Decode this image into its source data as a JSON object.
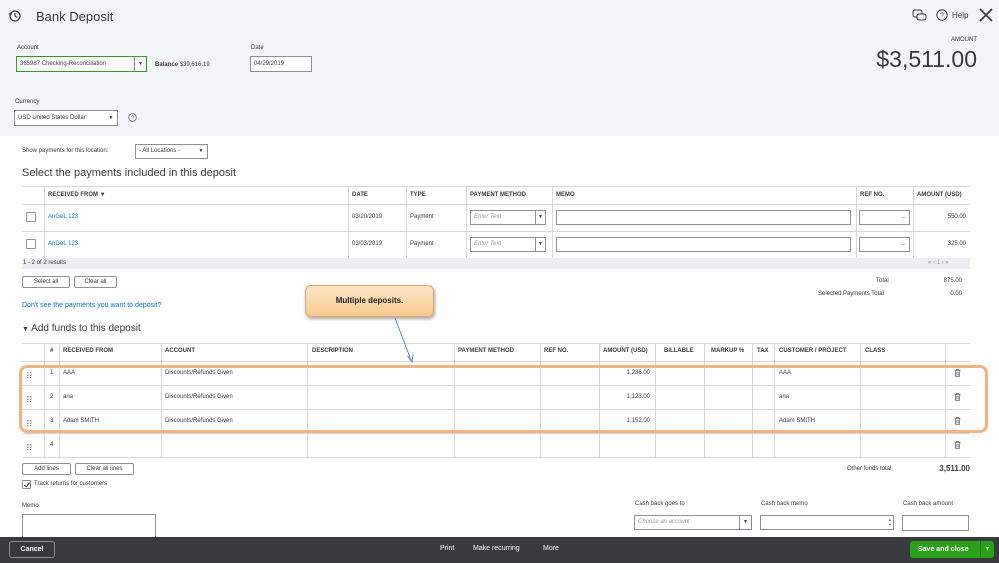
{
  "header": {
    "title": "Bank Deposit",
    "help_label": "Help",
    "amount_label": "AMOUNT",
    "amount_value": "$3,511.00"
  },
  "account": {
    "label": "Account",
    "value": "365987 Checking-Reconciliation",
    "balance_label": "Balance",
    "balance_value": "$39,616.19"
  },
  "date": {
    "label": "Date",
    "value": "04/29/2019"
  },
  "currency": {
    "label": "Currency",
    "value": "USD United States Dollar"
  },
  "location": {
    "label": "Show payments for this location:",
    "value": "- All Locations -"
  },
  "payments": {
    "title": "Select the payments included in this deposit",
    "columns": [
      "RECEIVED FROM",
      "DATE",
      "TYPE",
      "PAYMENT METHOD",
      "MEMO",
      "REF NO.",
      "AMOUNT (USD)"
    ],
    "rows": [
      {
        "received_from": "AnGeL 123",
        "date": "03/20/2019",
        "type": "Payment",
        "method_placeholder": "Enter Text",
        "ref": "...",
        "amount": "550.00"
      },
      {
        "received_from": "AnGeL 123",
        "date": "03/03/2019",
        "type": "Payment",
        "method_placeholder": "Enter Text",
        "ref": "...",
        "amount": "325.00"
      }
    ],
    "pager": "1 - 2 of 2 results",
    "pager_nav": "« ‹ 1 › »",
    "select_all": "Select all",
    "clear_all": "Clear all",
    "total_label": "Total",
    "total_value": "875.00",
    "selected_label": "Selected Payments Total",
    "selected_value": "0.00",
    "missing_link": "Don't see the payments you want to deposit?"
  },
  "funds": {
    "title": "Add funds to this deposit",
    "columns": [
      "#",
      "RECEIVED FROM",
      "ACCOUNT",
      "DESCRIPTION",
      "PAYMENT METHOD",
      "REF NO.",
      "AMOUNT (USD)",
      "BILLABLE",
      "MARKUP %",
      "TAX",
      "CUSTOMER / PROJECT",
      "CLASS"
    ],
    "rows": [
      {
        "num": "1",
        "received_from": "AAA",
        "account": "Discounts/Refunds Given",
        "amount": "1,236.00",
        "customer": "AAA"
      },
      {
        "num": "2",
        "received_from": "ana",
        "account": "Discounts/Refunds Given",
        "amount": "1,123.00",
        "customer": "ana"
      },
      {
        "num": "3",
        "received_from": "Adam SMITH",
        "account": "Discounts/Refunds Given",
        "amount": "1,152.00",
        "customer": "Adam SMITH"
      },
      {
        "num": "4",
        "received_from": "",
        "account": "",
        "amount": "",
        "customer": ""
      }
    ],
    "add_lines": "Add lines",
    "clear_all_lines": "Clear all lines",
    "other_total_label": "Other funds total",
    "other_total_value": "3,511.00",
    "track_returns": "Track returns for customers"
  },
  "callout": "Multiple deposits.",
  "memo": {
    "label": "Memo"
  },
  "cashback": {
    "goes_to_label": "Cash back goes to",
    "goes_to_placeholder": "Choose an account",
    "memo_label": "Cash back memo",
    "amount_label": "Cash back amount"
  },
  "footer": {
    "cancel": "Cancel",
    "print": "Print",
    "make_recurring": "Make recurring",
    "more": "More",
    "save_close": "Save and close"
  },
  "colors": {
    "accent_green": "#2ca01c",
    "link_blue": "#0077c5",
    "footer_bg": "#393a3d",
    "highlight": "#f3b37e"
  }
}
